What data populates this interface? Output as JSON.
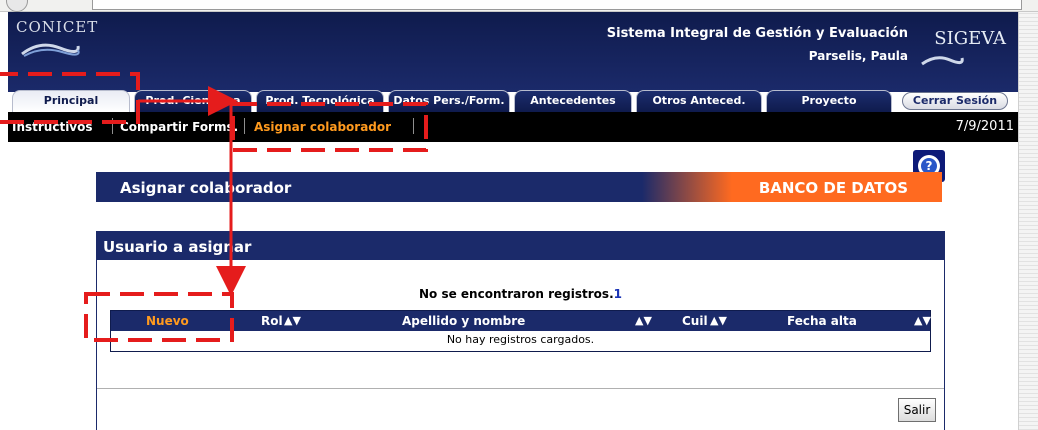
{
  "header": {
    "org_logo": "CONICET",
    "system_title": "Sistema Integral de Gestión y Evaluación",
    "user": "Parselis, Paula",
    "app_logo": "SIGEVA"
  },
  "tabs": [
    {
      "label": "Principal",
      "active": true
    },
    {
      "label": "Prod. Científica",
      "active": false
    },
    {
      "label": "Prod. Tecnológica",
      "active": false
    },
    {
      "label": "Datos Pers./Form.",
      "active": false
    },
    {
      "label": "Antecedentes",
      "active": false
    },
    {
      "label": "Otros Anteced.",
      "active": false
    },
    {
      "label": "Proyecto",
      "active": false
    }
  ],
  "logout_label": "Cerrar Sesión",
  "submenu": {
    "items": [
      "Instructivos",
      "Compartir Forms.",
      "Asignar colaborador"
    ],
    "active": "Asignar colaborador",
    "date": "7/9/2011"
  },
  "help_icon": "question-icon",
  "banner": {
    "title": "Asignar colaborador",
    "right_label": "BANCO DE DATOS"
  },
  "panel": {
    "title": "Usuario a asignar",
    "no_records_text": "No se encontraron registros.",
    "no_records_count": "1",
    "columns": [
      "Nuevo",
      "Rol",
      "Apellido y nombre",
      "Cuil",
      "Fecha alta"
    ],
    "empty_text": "No hay registros cargados.",
    "exit_label": "Salir"
  },
  "colors": {
    "navy": "#1b2a6a",
    "orange": "#ff6a20",
    "active_text": "#ff9a1e",
    "annotation": "#e51c1c"
  }
}
